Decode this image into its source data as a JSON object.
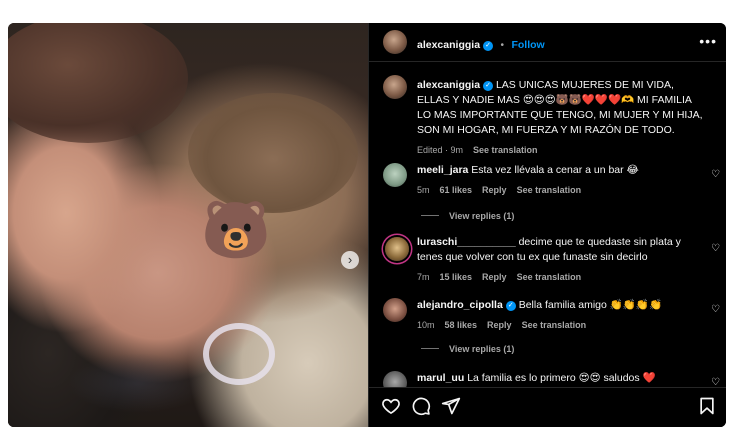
{
  "post": {
    "username": "alexcaniggia",
    "follow_label": "Follow",
    "more_label": "•••",
    "caption": "LAS UNICAS MUJERES DE MI VIDA, ELLAS Y NADIE MAS 😍😍😍🐻🐻❤️❤️❤️🫶 MI FAMILIA LO MAS IMPORTANTE QUE TENGO, MI MUJER Y MI HIJA, SON MI HOGAR, MI FUERZA Y MI RAZÓN DE TODO.",
    "edited_label": "Edited · 9m",
    "see_translation": "See translation",
    "photo_sticker": "🐻"
  },
  "comments": [
    {
      "username": "meeli_jara",
      "text": "Esta vez llévala a cenar a un bar 😂",
      "time": "5m",
      "likes": "61 likes",
      "reply": "Reply",
      "translate": "See translation",
      "view_replies": "View replies (1)"
    },
    {
      "username": "luraschi__________",
      "text": "decime que te quedaste sin plata y tenes que volver con tu ex que funaste sin decirlo",
      "time": "7m",
      "likes": "15 likes",
      "reply": "Reply",
      "translate": "See translation"
    },
    {
      "username": "alejandro_cipolla",
      "text": "Bella familia amigo 👏👏👏👏",
      "time": "10m",
      "likes": "58 likes",
      "reply": "Reply",
      "translate": "See translation",
      "view_replies": "View replies (1)"
    },
    {
      "username": "marul_uu",
      "text": "La familia es lo primero 😍😍 saludos ❤️"
    }
  ],
  "colors": {
    "accent": "#0095f6",
    "background": "#000000",
    "muted": "#a8a8a8"
  },
  "icons": [
    "heart-icon",
    "comment-icon",
    "share-icon",
    "bookmark-icon",
    "chevron-right-icon",
    "verified-icon"
  ]
}
